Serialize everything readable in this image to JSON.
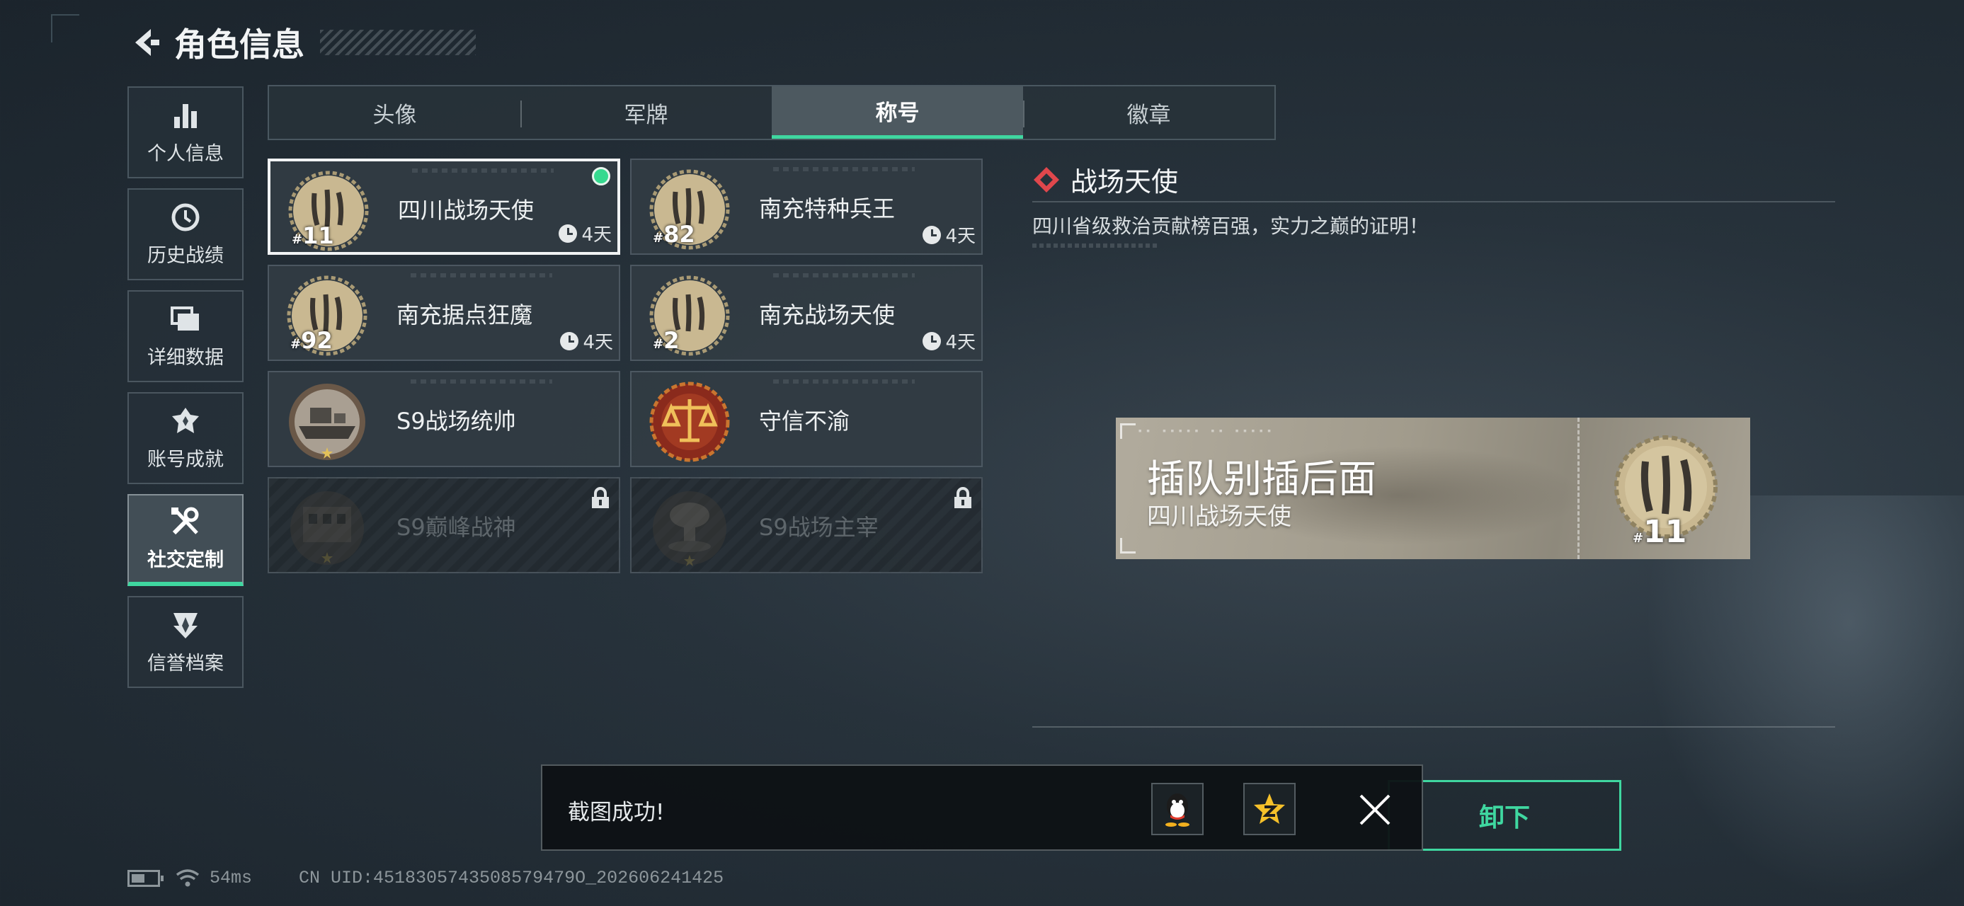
{
  "header": {
    "title": "角色信息"
  },
  "sidebar": {
    "items": [
      {
        "label": "个人信息",
        "icon": "bar-chart-icon"
      },
      {
        "label": "历史战绩",
        "icon": "history-icon"
      },
      {
        "label": "详细数据",
        "icon": "folder-icon"
      },
      {
        "label": "账号成就",
        "icon": "achievement-icon"
      },
      {
        "label": "社交定制",
        "icon": "tools-icon",
        "active": true
      },
      {
        "label": "信誉档案",
        "icon": "credit-badge-icon"
      }
    ]
  },
  "tabs": [
    {
      "label": "头像"
    },
    {
      "label": "军牌"
    },
    {
      "label": "称号",
      "active": true
    },
    {
      "label": "徽章"
    }
  ],
  "titles": [
    {
      "name": "四川战场天使",
      "rank": "11",
      "duration": "4天",
      "selected": true,
      "equipped": true
    },
    {
      "name": "南充特种兵王",
      "rank": "82",
      "duration": "4天"
    },
    {
      "name": "南充据点狂魔",
      "rank": "92",
      "duration": "4天"
    },
    {
      "name": "南充战场天使",
      "rank": "2",
      "duration": "4天"
    },
    {
      "name": "S9战场统帅",
      "icon": "battleship-medal-icon"
    },
    {
      "name": "守信不渝",
      "icon": "justice-scale-medal-icon"
    },
    {
      "name": "S9巅峰战神",
      "icon": "building-medal-icon",
      "locked": true
    },
    {
      "name": "S9战场主宰",
      "icon": "mushroom-cloud-medal-icon",
      "locked": true
    }
  ],
  "detail": {
    "title": "战场天使",
    "description": "四川省级救治贡献榜百强，实力之巅的证明！",
    "preview": {
      "player_name": "插队别插后面",
      "title": "四川战场天使",
      "rank": "11"
    }
  },
  "unequip_label": "卸下",
  "toast": {
    "message": "截图成功!",
    "share_targets": [
      "qq-icon",
      "qzone-icon"
    ]
  },
  "status": {
    "ping": "54ms",
    "uid": "CN UID:4518305743508579479O_202606241425"
  },
  "colors": {
    "accent": "#3fd7a0",
    "background": "#27323b",
    "gold": "#c9b891",
    "diamond": "#e0474c"
  }
}
